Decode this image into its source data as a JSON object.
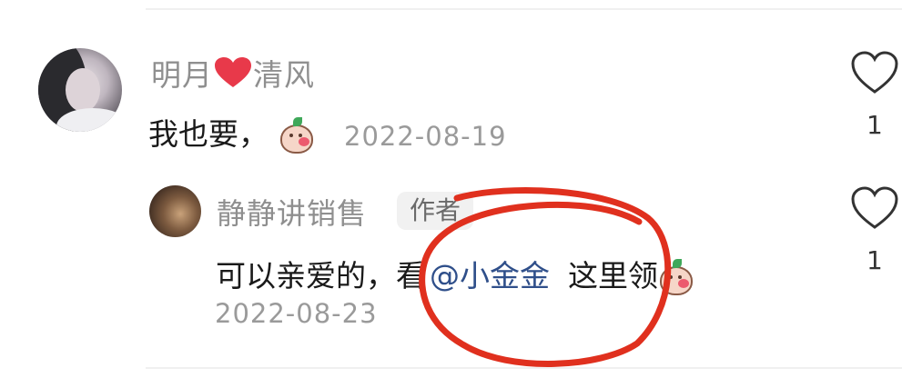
{
  "comment": {
    "username_part1": "明月",
    "username_part2": "清风",
    "text": "我也要，",
    "date": "2022-08-19",
    "like_count": "1"
  },
  "reply": {
    "username": "静静讲销售",
    "badge": "作者",
    "text_before": "可以亲爱的，看",
    "mention": "@小金金",
    "text_after": "这里领",
    "date": "2022-08-23",
    "like_count": "1"
  },
  "colors": {
    "mention": "#2f4f8a",
    "heart": "#e8394a",
    "annotation": "#e0301e"
  },
  "icons": [
    "heart-outline-icon",
    "red-heart-emoji",
    "peach-emoji"
  ]
}
